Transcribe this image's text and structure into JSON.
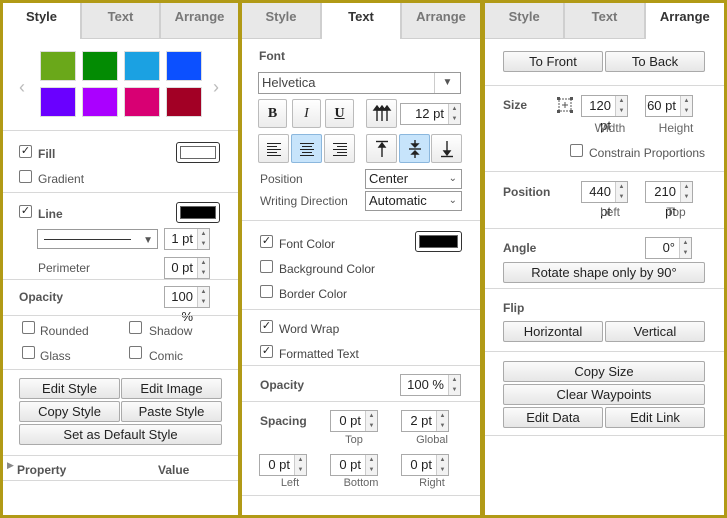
{
  "tabs": {
    "style": "Style",
    "text": "Text",
    "arrange": "Arrange"
  },
  "style_panel": {
    "swatches": [
      "#6aa81a",
      "#038b03",
      "#1ba1e2",
      "#0c50ff",
      "#6a00ff",
      "#aa00ff",
      "#d80073",
      "#a20025"
    ],
    "fill_label": "Fill",
    "fill_checked": true,
    "fill_color": "#ffffff",
    "gradient_label": "Gradient",
    "line_label": "Line",
    "line_checked": true,
    "line_color": "#000000",
    "line_width": "1 pt",
    "perimeter_label": "Perimeter",
    "perimeter_value": "0 pt",
    "opacity_label": "Opacity",
    "opacity_value": "100 %",
    "rounded_label": "Rounded",
    "shadow_label": "Shadow",
    "glass_label": "Glass",
    "comic_label": "Comic",
    "edit_style": "Edit Style",
    "edit_image": "Edit Image",
    "copy_style": "Copy Style",
    "paste_style": "Paste Style",
    "set_default": "Set as Default Style",
    "property_header": "Property",
    "value_header": "Value"
  },
  "text_panel": {
    "font_label": "Font",
    "font_name": "Helvetica",
    "font_size": "12 pt",
    "bold_label": "B",
    "italic_label": "I",
    "underline_label": "U",
    "position_label": "Position",
    "position_value": "Center",
    "writing_dir_label": "Writing Direction",
    "writing_dir_value": "Automatic",
    "font_color_label": "Font Color",
    "font_color": "#000000",
    "bg_color_label": "Background Color",
    "border_color_label": "Border Color",
    "word_wrap_label": "Word Wrap",
    "formatted_text_label": "Formatted Text",
    "opacity_label": "Opacity",
    "opacity_value": "100 %",
    "spacing_label": "Spacing",
    "top_value": "0 pt",
    "top_label": "Top",
    "global_value": "2 pt",
    "global_label": "Global",
    "left_value": "0 pt",
    "left_label": "Left",
    "bottom_value": "0 pt",
    "bottom_label": "Bottom",
    "right_value": "0 pt",
    "right_label": "Right"
  },
  "arrange_panel": {
    "to_front": "To Front",
    "to_back": "To Back",
    "size_label": "Size",
    "width_value": "120 pt",
    "width_label": "Width",
    "height_value": "60 pt",
    "height_label": "Height",
    "constrain_label": "Constrain Proportions",
    "position_label": "Position",
    "left_value": "440 pt",
    "left_label": "Left",
    "top_value": "210 pt",
    "top_label": "Top",
    "angle_label": "Angle",
    "angle_value": "0°",
    "rotate_button": "Rotate shape only by 90°",
    "flip_label": "Flip",
    "horizontal": "Horizontal",
    "vertical": "Vertical",
    "copy_size": "Copy Size",
    "clear_waypoints": "Clear Waypoints",
    "edit_data": "Edit Data",
    "edit_link": "Edit Link"
  }
}
